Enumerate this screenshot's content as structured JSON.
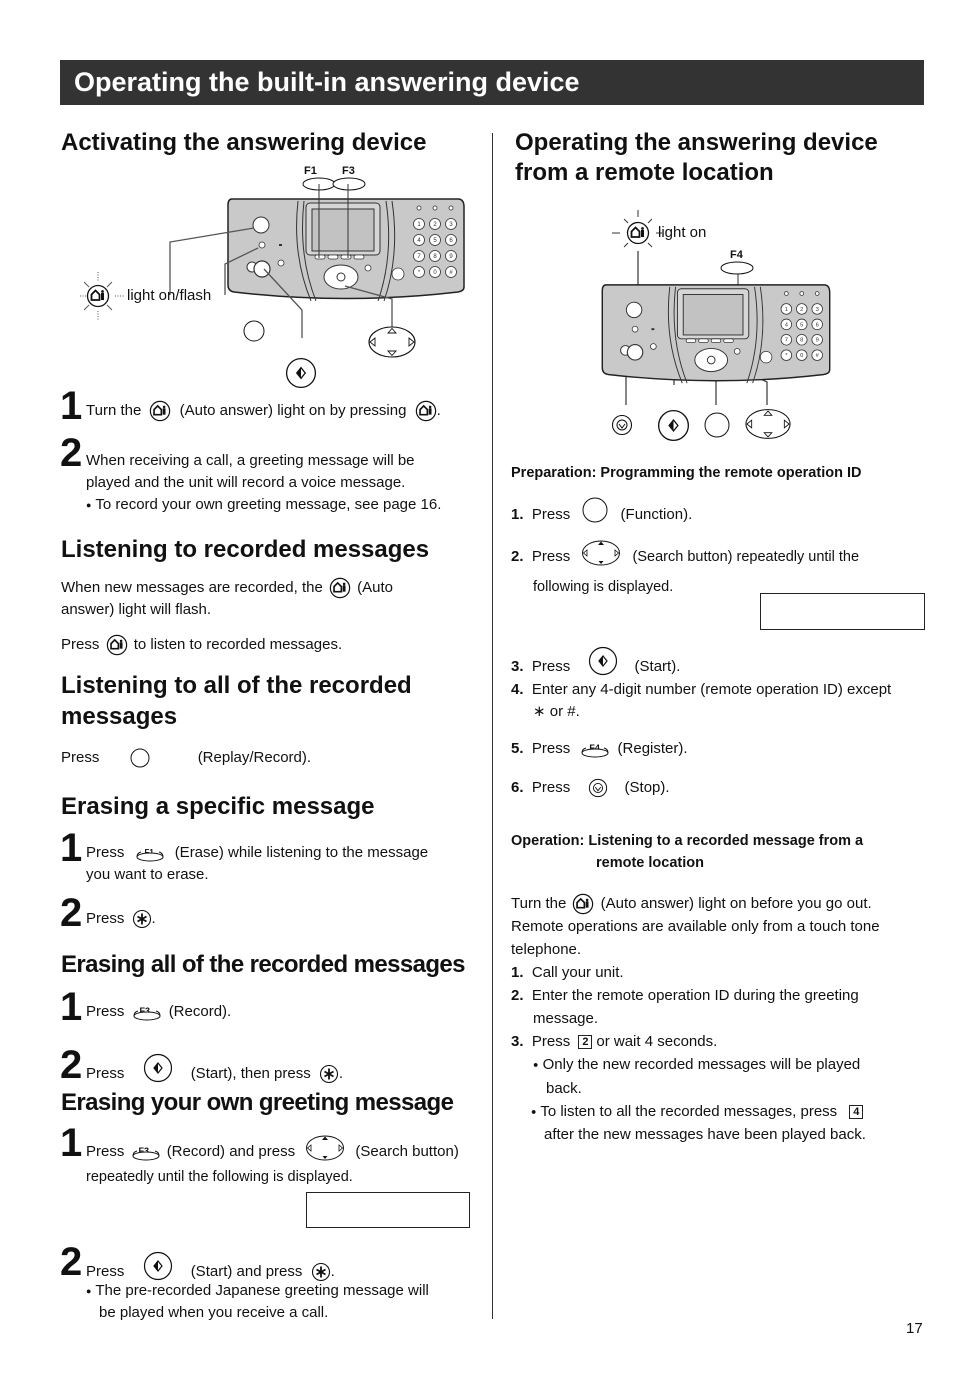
{
  "page_title": "Operating the built-in answering device",
  "page_number": "17",
  "left": {
    "activating": {
      "heading": "Activating the answering device",
      "diagram": {
        "callout_light": "light on/flash",
        "key_f1": "F1",
        "key_f3": "F3"
      },
      "step1": {
        "num": "1",
        "a": "Turn the",
        "b": "(Auto answer) light on by pressing",
        "c": "."
      },
      "step2": {
        "num": "2",
        "line1": "When receiving a call, a greeting message will be",
        "line2": "played and the unit will record a voice message.",
        "bullet": "To record your own greeting message, see page 16."
      }
    },
    "listening": {
      "heading": "Listening to recorded messages",
      "p1a": "When new messages are recorded, the",
      "p1b": "(Auto",
      "p1c": "answer) light will flash.",
      "p2a": "Press",
      "p2b": "to listen to recorded messages."
    },
    "listening_all": {
      "heading_line1": "Listening to all of the recorded",
      "heading_line2": "messages",
      "a": "Press",
      "b": "(Replay/Record)."
    },
    "erase_specific": {
      "heading": "Erasing a specific message",
      "step1": {
        "num": "1",
        "a": "Press",
        "key": "F1",
        "b": "(Erase) while listening to the message",
        "c": "you want to erase."
      },
      "step2": {
        "num": "2",
        "a": "Press",
        "b": "."
      }
    },
    "erase_all": {
      "heading": "Erasing all of the recorded messages",
      "step1": {
        "num": "1",
        "a": "Press",
        "key": "F3",
        "b": "(Record)."
      },
      "step2": {
        "num": "2",
        "a": "Press",
        "b": "(Start), then press",
        "c": "."
      }
    },
    "erase_greeting": {
      "heading": "Erasing your own greeting message",
      "step1": {
        "num": "1",
        "a": "Press",
        "key": "F3",
        "b": "(Record) and press",
        "c": "(Search button)",
        "d": "repeatedly until the following is displayed."
      },
      "display_text": "",
      "step2": {
        "num": "2",
        "a": "Press",
        "b": "(Start) and press",
        "c": ".",
        "bullet_line1": "The pre-recorded Japanese greeting message will",
        "bullet_line2": "be played when you receive a call."
      }
    }
  },
  "right": {
    "heading_line1": "Operating the answering device",
    "heading_line2": "from a remote location",
    "diagram": {
      "callout_light": "light on",
      "key_f4": "F4"
    },
    "preparation": {
      "heading": "Preparation: Programming the remote operation ID",
      "steps": [
        {
          "num": "1.",
          "a": "Press",
          "b": "(Function)."
        },
        {
          "num": "2.",
          "a": "Press",
          "b": "(Search button) repeatedly until the",
          "c": "following is displayed."
        },
        {
          "num": "3.",
          "a": "Press",
          "b": "(Start)."
        },
        {
          "num": "4.",
          "a": "Enter any 4-digit number (remote operation ID) except",
          "b": "∗ or #."
        },
        {
          "num": "5.",
          "a": "Press",
          "key": "F4",
          "b": "(Register)."
        },
        {
          "num": "6.",
          "a": "Press",
          "b": "(Stop)."
        }
      ],
      "display_text": ""
    },
    "operation": {
      "heading_line1": "Operation: Listening to a recorded message from a",
      "heading_line2": "remote location",
      "intro_a": "Turn the",
      "intro_b": "(Auto answer) light on before you go out.",
      "intro_c": "Remote operations are available only from a touch tone",
      "intro_d": "telephone.",
      "steps": [
        {
          "num": "1.",
          "text": "Call your unit."
        },
        {
          "num": "2.",
          "text": "Enter the remote operation ID during the greeting",
          "text2": "message."
        },
        {
          "num": "3.",
          "a": "Press",
          "key": "2",
          "b": "or wait 4 seconds."
        }
      ],
      "bullets": [
        {
          "line1": "Only the new recorded messages will be played",
          "line2": "back."
        },
        {
          "line1": "To listen to all the recorded messages, press",
          "key": "4",
          "line2": "after the new messages have been played back."
        }
      ]
    }
  },
  "icons": {
    "auto_answer": "auto-answer-icon",
    "start": "start-icon",
    "stop": "stop-icon",
    "star_key": "star-key-icon",
    "search": "search-button-icon",
    "function": "function-button-icon",
    "replay": "replay-record-icon"
  }
}
